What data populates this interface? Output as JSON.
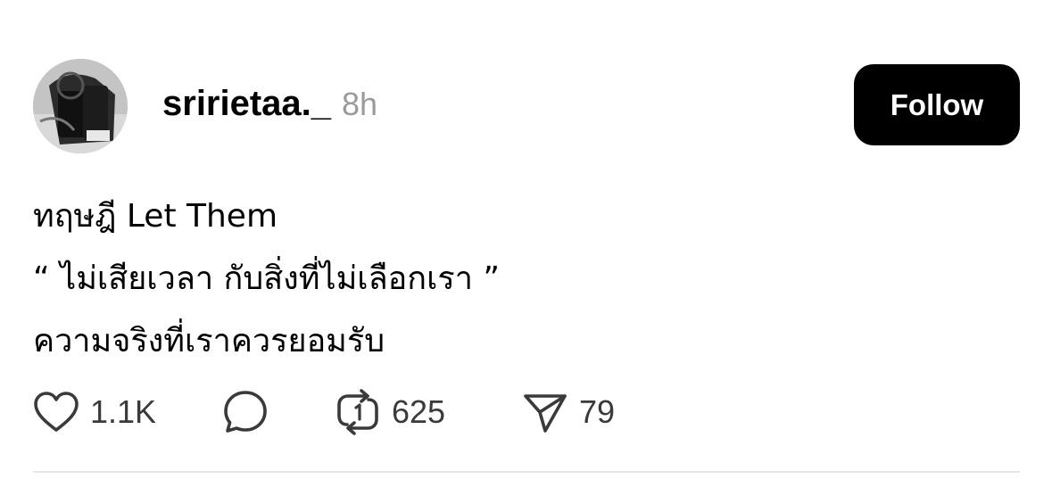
{
  "post": {
    "author": {
      "username": "sririetaa._",
      "time": "8h"
    },
    "follow_label": "Follow",
    "text_lines": [
      "ทฤษฎี Let Them",
      "“ ไม่เสียเวลา กับสิ่งที่ไม่เลือกเรา ”",
      "ความจริงที่เราควรยอมรับ"
    ],
    "actions": {
      "like": {
        "icon": "heart-icon",
        "count": "1.1K"
      },
      "reply": {
        "icon": "comment-icon",
        "count": ""
      },
      "repost": {
        "icon": "repost-icon",
        "count": "625"
      },
      "share": {
        "icon": "send-icon",
        "count": "79"
      }
    }
  }
}
